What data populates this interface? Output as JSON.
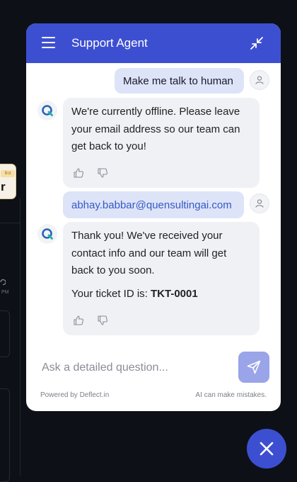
{
  "background": {
    "card_tag": "Bot",
    "card_letter": "r",
    "time_text": "PM"
  },
  "header": {
    "title": "Support Agent",
    "bg_color": "#3d4fd1"
  },
  "messages": [
    {
      "role": "user",
      "text": "Make me talk to human"
    },
    {
      "role": "bot",
      "text": "We're currently offline. Please leave your email address so our team can get back to you!"
    },
    {
      "role": "user",
      "text": "abhay.babbar@quensultingai.com"
    },
    {
      "role": "bot",
      "text": "Thank you! We've received your contact info and our team will get back to you soon.",
      "ticket_prefix": "Your ticket ID is: ",
      "ticket_id": "TKT-0001"
    }
  ],
  "icons": {
    "menu": "hamburger-icon",
    "collapse": "collapse-arrows-icon",
    "user_avatar": "user-icon",
    "bot_avatar": "q-logo-icon",
    "thumbs_up": "thumbs-up-icon",
    "thumbs_down": "thumbs-down-icon",
    "send": "send-icon",
    "close": "close-icon"
  },
  "input": {
    "placeholder": "Ask a detailed question...",
    "value": ""
  },
  "footer": {
    "powered_by": "Powered by Deflect.in",
    "disclaimer": "AI can make mistakes."
  },
  "colors": {
    "accent": "#3d4fd1",
    "user_bubble": "#dde4f8",
    "bot_bubble": "#f0f1f5",
    "link": "#3559c7",
    "send_button": "#9aa4e8"
  }
}
